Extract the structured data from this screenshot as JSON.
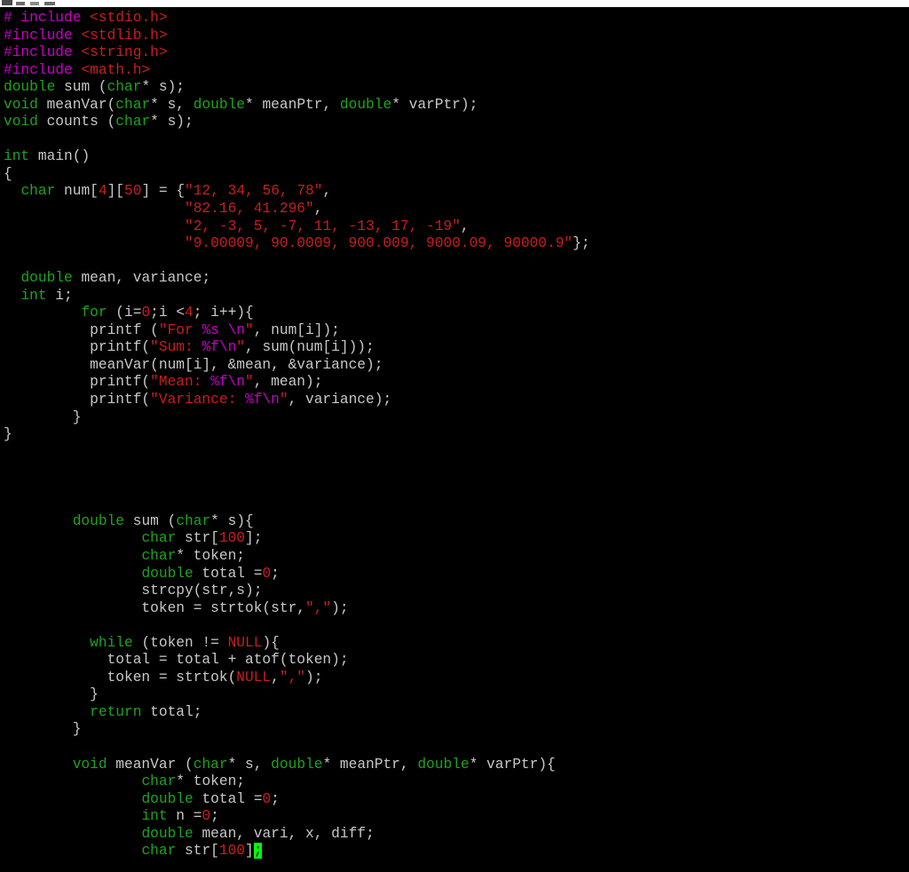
{
  "window": {
    "title": ""
  },
  "theme": {
    "background": "#000000",
    "text": "#c8c8c8",
    "preprocessor": "#c400c4",
    "keyword": "#1fa21f",
    "literal": "#c81e1e",
    "cursor": "#00ff00"
  },
  "editor": {
    "cursor": {
      "line": 48,
      "char": ";"
    },
    "lines": [
      [
        {
          "t": "# include ",
          "c": "pre"
        },
        {
          "t": "<stdio.h>",
          "c": "lit"
        }
      ],
      [
        {
          "t": "#include ",
          "c": "pre"
        },
        {
          "t": "<stdlib.h>",
          "c": "lit"
        }
      ],
      [
        {
          "t": "#include ",
          "c": "pre"
        },
        {
          "t": "<string.h>",
          "c": "lit"
        }
      ],
      [
        {
          "t": "#include ",
          "c": "pre"
        },
        {
          "t": "<math.h>",
          "c": "lit"
        }
      ],
      [
        {
          "t": "double",
          "c": "kw"
        },
        {
          "t": " sum (",
          "c": "tx"
        },
        {
          "t": "char",
          "c": "kw"
        },
        {
          "t": "* s);",
          "c": "tx"
        }
      ],
      [
        {
          "t": "void",
          "c": "kw"
        },
        {
          "t": " meanVar(",
          "c": "tx"
        },
        {
          "t": "char",
          "c": "kw"
        },
        {
          "t": "* s, ",
          "c": "tx"
        },
        {
          "t": "double",
          "c": "kw"
        },
        {
          "t": "* meanPtr, ",
          "c": "tx"
        },
        {
          "t": "double",
          "c": "kw"
        },
        {
          "t": "* varPtr);",
          "c": "tx"
        }
      ],
      [
        {
          "t": "void",
          "c": "kw"
        },
        {
          "t": " counts (",
          "c": "tx"
        },
        {
          "t": "char",
          "c": "kw"
        },
        {
          "t": "* s);",
          "c": "tx"
        }
      ],
      [],
      [
        {
          "t": "int",
          "c": "kw"
        },
        {
          "t": " main()",
          "c": "tx"
        }
      ],
      [
        {
          "t": "{",
          "c": "tx"
        }
      ],
      [
        {
          "t": "  ",
          "c": "tx"
        },
        {
          "t": "char",
          "c": "kw"
        },
        {
          "t": " num[",
          "c": "tx"
        },
        {
          "t": "4",
          "c": "lit"
        },
        {
          "t": "][",
          "c": "tx"
        },
        {
          "t": "50",
          "c": "lit"
        },
        {
          "t": "] = {",
          "c": "tx"
        },
        {
          "t": "\"12, 34, 56, 78\"",
          "c": "lit"
        },
        {
          "t": ",",
          "c": "tx"
        }
      ],
      [
        {
          "t": "                     ",
          "c": "tx"
        },
        {
          "t": "\"82.16, 41.296\"",
          "c": "lit"
        },
        {
          "t": ",",
          "c": "tx"
        }
      ],
      [
        {
          "t": "                     ",
          "c": "tx"
        },
        {
          "t": "\"2, -3, 5, -7, 11, -13, 17, -19\"",
          "c": "lit"
        },
        {
          "t": ",",
          "c": "tx"
        }
      ],
      [
        {
          "t": "                     ",
          "c": "tx"
        },
        {
          "t": "\"9.00009, 90.0009, 900.009, 9000.09, 90000.9\"",
          "c": "lit"
        },
        {
          "t": "};",
          "c": "tx"
        }
      ],
      [],
      [
        {
          "t": "  ",
          "c": "tx"
        },
        {
          "t": "double",
          "c": "kw"
        },
        {
          "t": " mean, variance;",
          "c": "tx"
        }
      ],
      [
        {
          "t": "  ",
          "c": "tx"
        },
        {
          "t": "int",
          "c": "kw"
        },
        {
          "t": " i;",
          "c": "tx"
        }
      ],
      [
        {
          "t": "         ",
          "c": "tx"
        },
        {
          "t": "for",
          "c": "kw"
        },
        {
          "t": " (i=",
          "c": "tx"
        },
        {
          "t": "0",
          "c": "lit"
        },
        {
          "t": ";i <",
          "c": "tx"
        },
        {
          "t": "4",
          "c": "lit"
        },
        {
          "t": "; i++){",
          "c": "tx"
        }
      ],
      [
        {
          "t": "          printf (",
          "c": "tx"
        },
        {
          "t": "\"For ",
          "c": "lit"
        },
        {
          "t": "%s \\n",
          "c": "pre"
        },
        {
          "t": "\"",
          "c": "lit"
        },
        {
          "t": ", num[i]);",
          "c": "tx"
        }
      ],
      [
        {
          "t": "          printf(",
          "c": "tx"
        },
        {
          "t": "\"Sum: ",
          "c": "lit"
        },
        {
          "t": "%f\\n",
          "c": "pre"
        },
        {
          "t": "\"",
          "c": "lit"
        },
        {
          "t": ", sum(num[i]));",
          "c": "tx"
        }
      ],
      [
        {
          "t": "          meanVar(num[i], &mean, &variance);",
          "c": "tx"
        }
      ],
      [
        {
          "t": "          printf(",
          "c": "tx"
        },
        {
          "t": "\"Mean: ",
          "c": "lit"
        },
        {
          "t": "%f\\n",
          "c": "pre"
        },
        {
          "t": "\"",
          "c": "lit"
        },
        {
          "t": ", mean);",
          "c": "tx"
        }
      ],
      [
        {
          "t": "          printf(",
          "c": "tx"
        },
        {
          "t": "\"Variance: ",
          "c": "lit"
        },
        {
          "t": "%f\\n",
          "c": "pre"
        },
        {
          "t": "\"",
          "c": "lit"
        },
        {
          "t": ", variance);",
          "c": "tx"
        }
      ],
      [
        {
          "t": "        }",
          "c": "tx"
        }
      ],
      [
        {
          "t": "}",
          "c": "tx"
        }
      ],
      [],
      [],
      [],
      [],
      [
        {
          "t": "        ",
          "c": "tx"
        },
        {
          "t": "double",
          "c": "kw"
        },
        {
          "t": " sum (",
          "c": "tx"
        },
        {
          "t": "char",
          "c": "kw"
        },
        {
          "t": "* s){",
          "c": "tx"
        }
      ],
      [
        {
          "t": "                ",
          "c": "tx"
        },
        {
          "t": "char",
          "c": "kw"
        },
        {
          "t": " str[",
          "c": "tx"
        },
        {
          "t": "100",
          "c": "lit"
        },
        {
          "t": "];",
          "c": "tx"
        }
      ],
      [
        {
          "t": "                ",
          "c": "tx"
        },
        {
          "t": "char",
          "c": "kw"
        },
        {
          "t": "* token;",
          "c": "tx"
        }
      ],
      [
        {
          "t": "                ",
          "c": "tx"
        },
        {
          "t": "double",
          "c": "kw"
        },
        {
          "t": " total =",
          "c": "tx"
        },
        {
          "t": "0",
          "c": "lit"
        },
        {
          "t": ";",
          "c": "tx"
        }
      ],
      [
        {
          "t": "                strcpy(str,s);",
          "c": "tx"
        }
      ],
      [
        {
          "t": "                token = strtok(str,",
          "c": "tx"
        },
        {
          "t": "\",\"",
          "c": "lit"
        },
        {
          "t": ");",
          "c": "tx"
        }
      ],
      [],
      [
        {
          "t": "          ",
          "c": "tx"
        },
        {
          "t": "while",
          "c": "kw"
        },
        {
          "t": " (token != ",
          "c": "tx"
        },
        {
          "t": "NULL",
          "c": "lit"
        },
        {
          "t": "){",
          "c": "tx"
        }
      ],
      [
        {
          "t": "            total = total + atof(token);",
          "c": "tx"
        }
      ],
      [
        {
          "t": "            token = strtok(",
          "c": "tx"
        },
        {
          "t": "NULL",
          "c": "lit"
        },
        {
          "t": ",",
          "c": "tx"
        },
        {
          "t": "\",\"",
          "c": "lit"
        },
        {
          "t": ");",
          "c": "tx"
        }
      ],
      [
        {
          "t": "          }",
          "c": "tx"
        }
      ],
      [
        {
          "t": "          ",
          "c": "tx"
        },
        {
          "t": "return",
          "c": "kw"
        },
        {
          "t": " total;",
          "c": "tx"
        }
      ],
      [
        {
          "t": "        }",
          "c": "tx"
        }
      ],
      [],
      [
        {
          "t": "        ",
          "c": "tx"
        },
        {
          "t": "void",
          "c": "kw"
        },
        {
          "t": " meanVar (",
          "c": "tx"
        },
        {
          "t": "char",
          "c": "kw"
        },
        {
          "t": "* s, ",
          "c": "tx"
        },
        {
          "t": "double",
          "c": "kw"
        },
        {
          "t": "* meanPtr, ",
          "c": "tx"
        },
        {
          "t": "double",
          "c": "kw"
        },
        {
          "t": "* varPtr){",
          "c": "tx"
        }
      ],
      [
        {
          "t": "                ",
          "c": "tx"
        },
        {
          "t": "char",
          "c": "kw"
        },
        {
          "t": "* token;",
          "c": "tx"
        }
      ],
      [
        {
          "t": "                ",
          "c": "tx"
        },
        {
          "t": "double",
          "c": "kw"
        },
        {
          "t": " total =",
          "c": "tx"
        },
        {
          "t": "0",
          "c": "lit"
        },
        {
          "t": ";",
          "c": "tx"
        }
      ],
      [
        {
          "t": "                ",
          "c": "tx"
        },
        {
          "t": "int",
          "c": "kw"
        },
        {
          "t": " n =",
          "c": "tx"
        },
        {
          "t": "0",
          "c": "lit"
        },
        {
          "t": ";",
          "c": "tx"
        }
      ],
      [
        {
          "t": "                ",
          "c": "tx"
        },
        {
          "t": "double",
          "c": "kw"
        },
        {
          "t": " mean, vari, x, diff;",
          "c": "tx"
        }
      ],
      [
        {
          "t": "                ",
          "c": "tx"
        },
        {
          "t": "char",
          "c": "kw"
        },
        {
          "t": " str[",
          "c": "tx"
        },
        {
          "t": "100",
          "c": "lit"
        },
        {
          "t": "]",
          "c": "tx"
        }
      ]
    ]
  }
}
